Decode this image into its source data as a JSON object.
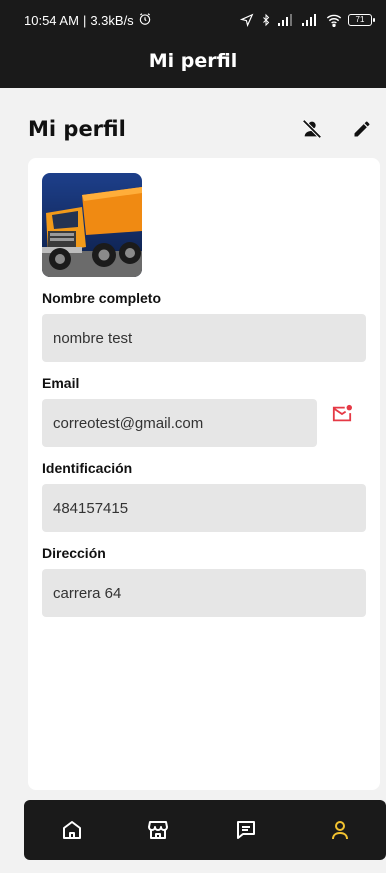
{
  "status_bar": {
    "time": "10:54 AM",
    "separator": "|",
    "speed": "3.3kB/s",
    "battery": "71"
  },
  "app_bar": {
    "title": "Mi perfil"
  },
  "profile": {
    "section_title": "Mi perfil",
    "actions": [
      {
        "icon": "person-off-icon"
      },
      {
        "icon": "edit-pencil-icon"
      }
    ],
    "fields": [
      {
        "label": "Nombre completo",
        "value": "nombre test"
      },
      {
        "label": "Email",
        "value": "correotest@gmail.com",
        "action_icon": "mail-unread-icon"
      },
      {
        "label": "Identificación",
        "value": "484157415"
      },
      {
        "label": "Dirección",
        "value": "carrera 64"
      }
    ]
  },
  "bottom_nav": {
    "items": [
      {
        "icon": "home-icon",
        "active": false
      },
      {
        "icon": "store-icon",
        "active": false
      },
      {
        "icon": "chat-icon",
        "active": false
      },
      {
        "icon": "user-icon",
        "active": true
      }
    ]
  },
  "colors": {
    "bar_bg": "#1a1a1a",
    "page_bg": "#f2f2f2",
    "field_bg": "#e6e6e6",
    "accent_yellow": "#f2c230",
    "alert_red": "#e53945"
  }
}
